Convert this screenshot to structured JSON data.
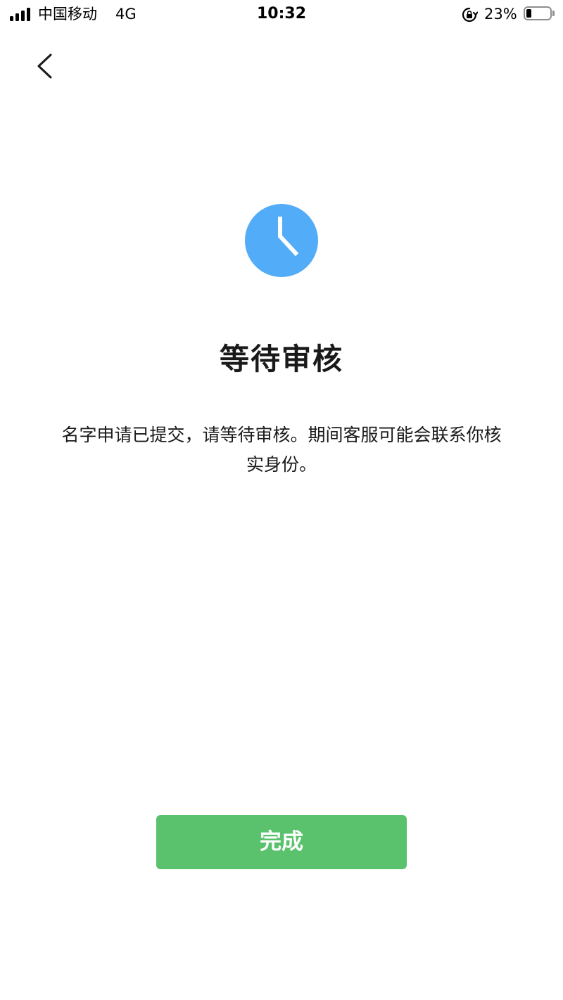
{
  "status_bar": {
    "carrier": "中国移动",
    "network": "4G",
    "time": "10:32",
    "battery_percent_text": "23%",
    "battery_level": 0.23,
    "icons": {
      "signal": "cellular-signal-icon",
      "rotation_lock": "rotation-lock-icon",
      "battery": "battery-icon"
    }
  },
  "nav": {
    "back_icon": "chevron-left-icon"
  },
  "status_icon": "clock-icon",
  "title": "等待审核",
  "description": "名字申请已提交，请等待审核。期间客服可能会联系你核实身份。",
  "done_button": {
    "label": "完成"
  },
  "colors": {
    "accent_blue": "#52acf7",
    "button_green": "#5ac16d",
    "text_primary": "#1a1a1a",
    "background": "#ffffff"
  }
}
